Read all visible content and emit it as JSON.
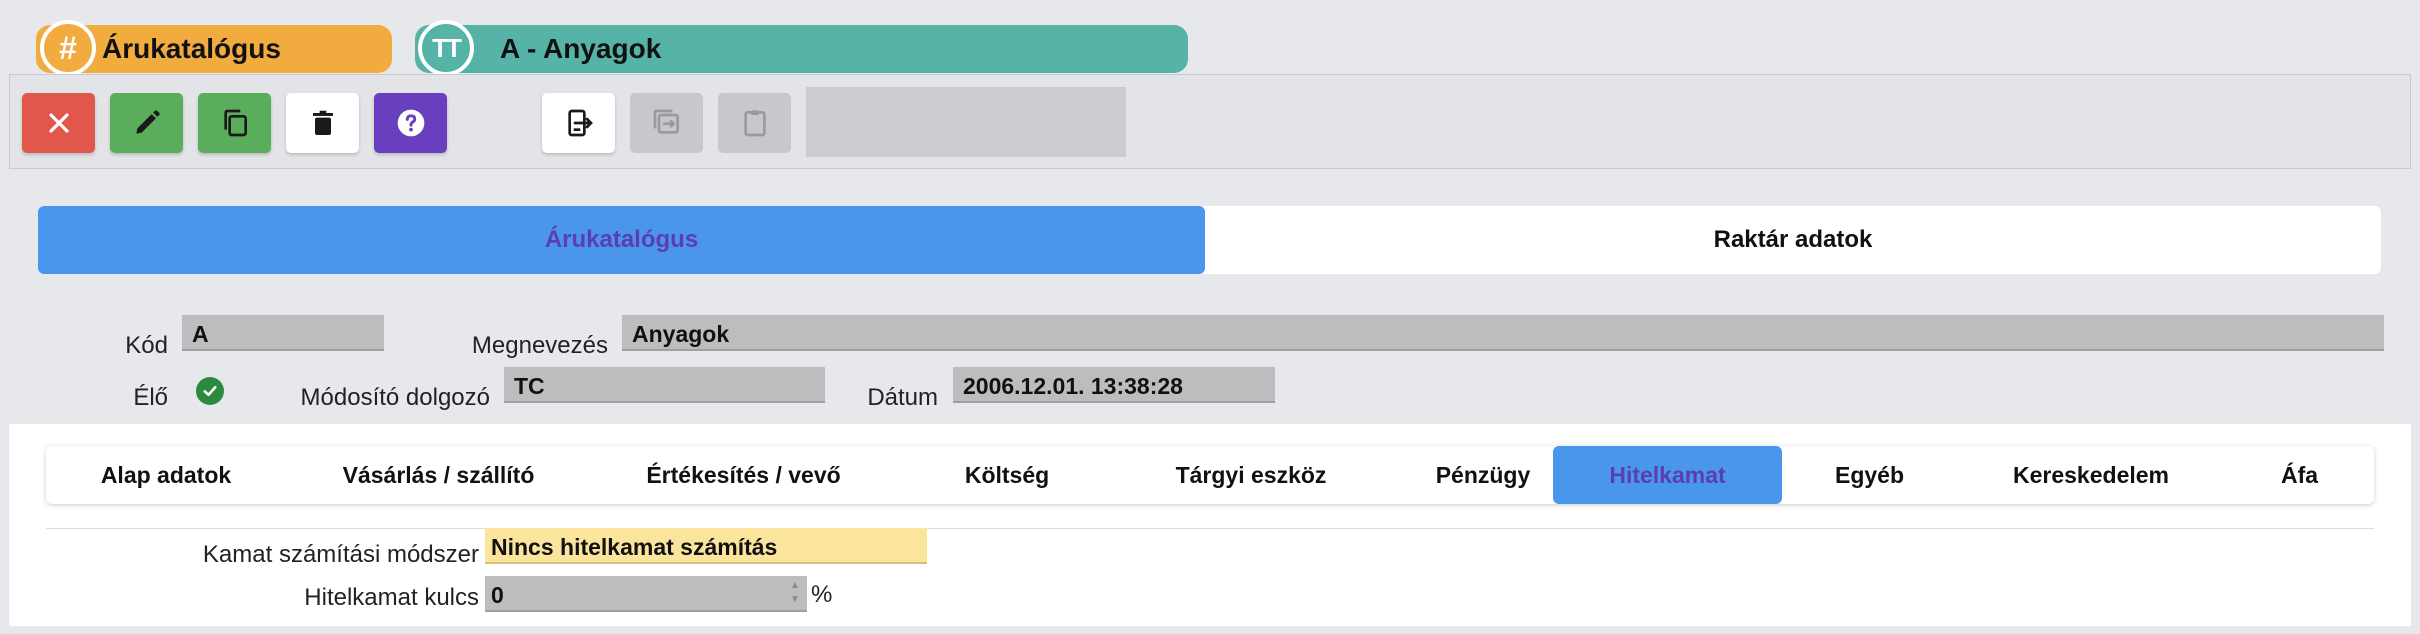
{
  "breadcrumb": {
    "category": {
      "icon": "hash-icon",
      "glyph": "#",
      "label": "Árukatalógus",
      "color": "#f2ab3f"
    },
    "item": {
      "icon": "text-type-icon",
      "glyph": "TT",
      "label": "A - Anyagok",
      "color": "#55b3a7"
    }
  },
  "toolbar": {
    "buttons": [
      {
        "name": "close",
        "icon": "close-icon",
        "color": "#e2574c"
      },
      {
        "name": "edit",
        "icon": "pencil-icon",
        "color": "#5aae5b"
      },
      {
        "name": "copy",
        "icon": "copy-icon",
        "color": "#5aae5b"
      },
      {
        "name": "delete",
        "icon": "trash-icon",
        "color": "#ffffff"
      },
      {
        "name": "help",
        "icon": "help-icon",
        "color": "#6a3fbf"
      },
      {
        "name": "export",
        "icon": "export-icon",
        "color": "#ffffff"
      },
      {
        "name": "import",
        "icon": "import-icon",
        "disabled": true
      },
      {
        "name": "paste",
        "icon": "clipboard-icon",
        "disabled": true
      }
    ]
  },
  "main_tabs": [
    {
      "label": "Árukatalógus",
      "active": true
    },
    {
      "label": "Raktár adatok",
      "active": false
    }
  ],
  "form": {
    "kod_label": "Kód",
    "kod_value": "A",
    "megnevezes_label": "Megnevezés",
    "megnevezes_value": "Anyagok",
    "elo_label": "Élő",
    "elo_value": true,
    "modosito_label": "Módosító dolgozó",
    "modosito_value": "TC",
    "datum_label": "Dátum",
    "datum_value": "2006.12.01. 13:38:28"
  },
  "sub_tabs": [
    {
      "label": "Alap adatok",
      "active": false
    },
    {
      "label": "Vásárlás / szállító",
      "active": false
    },
    {
      "label": "Értékesítés / vevő",
      "active": false
    },
    {
      "label": "Költség",
      "active": false
    },
    {
      "label": "Tárgyi eszköz",
      "active": false
    },
    {
      "label": "Pénzügy",
      "active": false
    },
    {
      "label": "Hitelkamat",
      "active": true
    },
    {
      "label": "Egyéb",
      "active": false
    },
    {
      "label": "Kereskedelem",
      "active": false
    },
    {
      "label": "Áfa",
      "active": false
    }
  ],
  "hitelkamat": {
    "method_label": "Kamat számítási módszer",
    "method_value": "Nincs hitelkamat számítás",
    "rate_label": "Hitelkamat kulcs",
    "rate_value": "0",
    "rate_unit": "%"
  },
  "colors": {
    "accent_blue": "#4a96ec",
    "active_tab_text": "#5b3fb0",
    "success": "#2b8a3e",
    "highlight_field": "#fbe59c"
  }
}
